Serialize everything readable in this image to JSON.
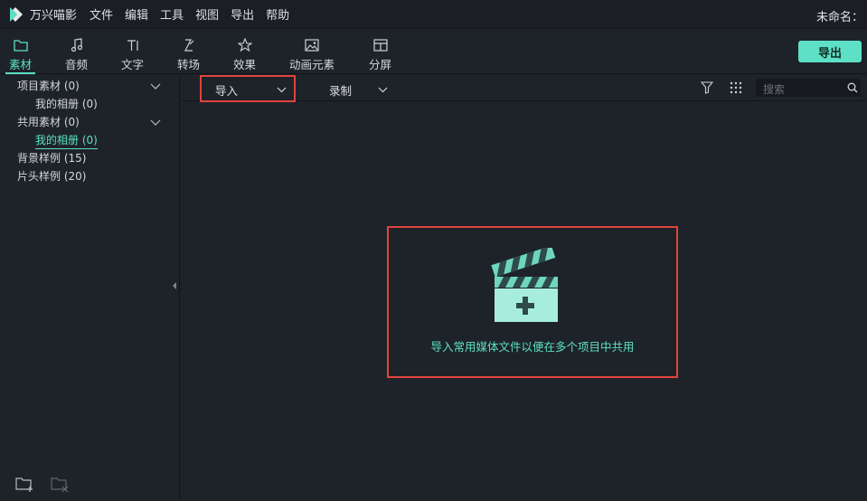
{
  "app": {
    "name": "万兴喵影",
    "project_title": "未命名："
  },
  "menu": [
    "文件",
    "编辑",
    "工具",
    "视图",
    "导出",
    "帮助"
  ],
  "tabs": [
    {
      "label": "素材",
      "icon": "folder-icon",
      "active": true
    },
    {
      "label": "音频",
      "icon": "music-note-icon",
      "active": false
    },
    {
      "label": "文字",
      "icon": "text-icon",
      "active": false
    },
    {
      "label": "转场",
      "icon": "transition-icon",
      "active": false
    },
    {
      "label": "效果",
      "icon": "effects-icon",
      "active": false
    },
    {
      "label": "动画元素",
      "icon": "image-icon",
      "active": false
    },
    {
      "label": "分屏",
      "icon": "split-screen-icon",
      "active": false
    }
  ],
  "export_button": "导出",
  "library_tree": [
    {
      "label": "项目素材 (0)",
      "level": 0,
      "expandable": true
    },
    {
      "label": "我的相册 (0)",
      "level": 1,
      "expandable": false
    },
    {
      "label": "共用素材 (0)",
      "level": 0,
      "expandable": true
    },
    {
      "label": "我的相册 (0)",
      "level": 1,
      "expandable": false,
      "selected": true
    },
    {
      "label": "背景样例 (15)",
      "level": 0,
      "expandable": false
    },
    {
      "label": "片头样例 (20)",
      "level": 0,
      "expandable": false
    }
  ],
  "subtoolbar": {
    "import_label": "导入",
    "record_label": "录制",
    "search_placeholder": "搜索"
  },
  "empty_state": {
    "message": "导入常用媒体文件以便在多个项目中共用",
    "icon": "clapperboard-add-icon"
  },
  "colors": {
    "accent": "#5de0c5",
    "highlight_border": "#e0433a",
    "background": "#1e232a"
  }
}
